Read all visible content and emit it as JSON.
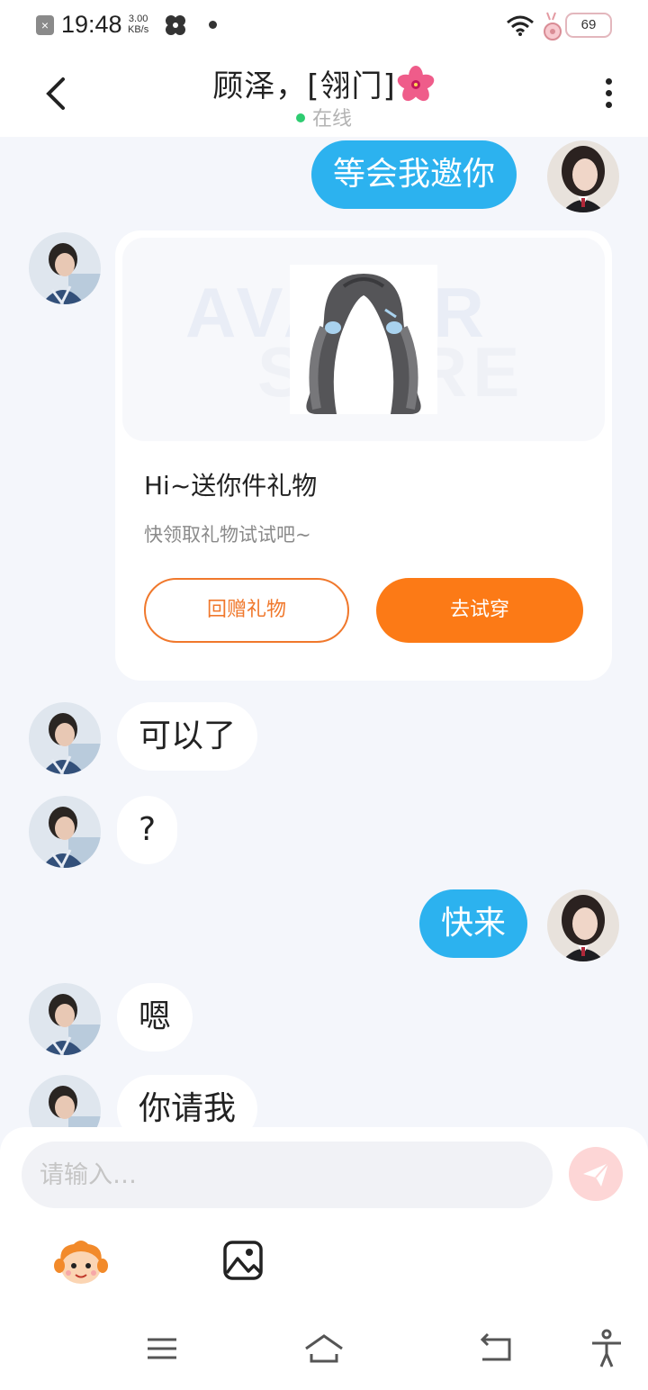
{
  "status_bar": {
    "time": "19:48",
    "speed_value": "3.00",
    "speed_unit": "KB/s",
    "battery": "69"
  },
  "header": {
    "contact_name": "顾泽，[翎门]",
    "status": "在线",
    "icons": [
      "back-arrow-icon",
      "hibiscus-emoji",
      "more-vertical-icon"
    ]
  },
  "messages": [
    {
      "from": "me",
      "text": "等会我邀你"
    },
    {
      "from": "other",
      "type": "gift_card"
    },
    {
      "from": "other",
      "text": "可以了"
    },
    {
      "from": "other",
      "text": "?"
    },
    {
      "from": "me",
      "text": "快来"
    },
    {
      "from": "other",
      "text": "嗯"
    },
    {
      "from": "other",
      "text": "你请我"
    }
  ],
  "gift_card": {
    "watermark_line1": "AVATAR",
    "watermark_line2": "STORE",
    "title": "Hi~送你件礼物",
    "subtitle": "快领取礼物试试吧~",
    "return_gift_label": "回赠礼物",
    "try_on_label": "去试穿"
  },
  "input": {
    "placeholder": "请输入…",
    "send_icon": "paper-plane-icon",
    "tools": [
      "emoji-mascot-icon",
      "image-icon"
    ]
  },
  "colors": {
    "my_bubble": "#2cb2ef",
    "accent_orange": "#fc7a16",
    "online_dot": "#2ecc71",
    "chat_background": "#f4f6fb"
  },
  "nav_icons": [
    "menu-icon",
    "home-icon",
    "back-icon",
    "accessibility-icon"
  ]
}
